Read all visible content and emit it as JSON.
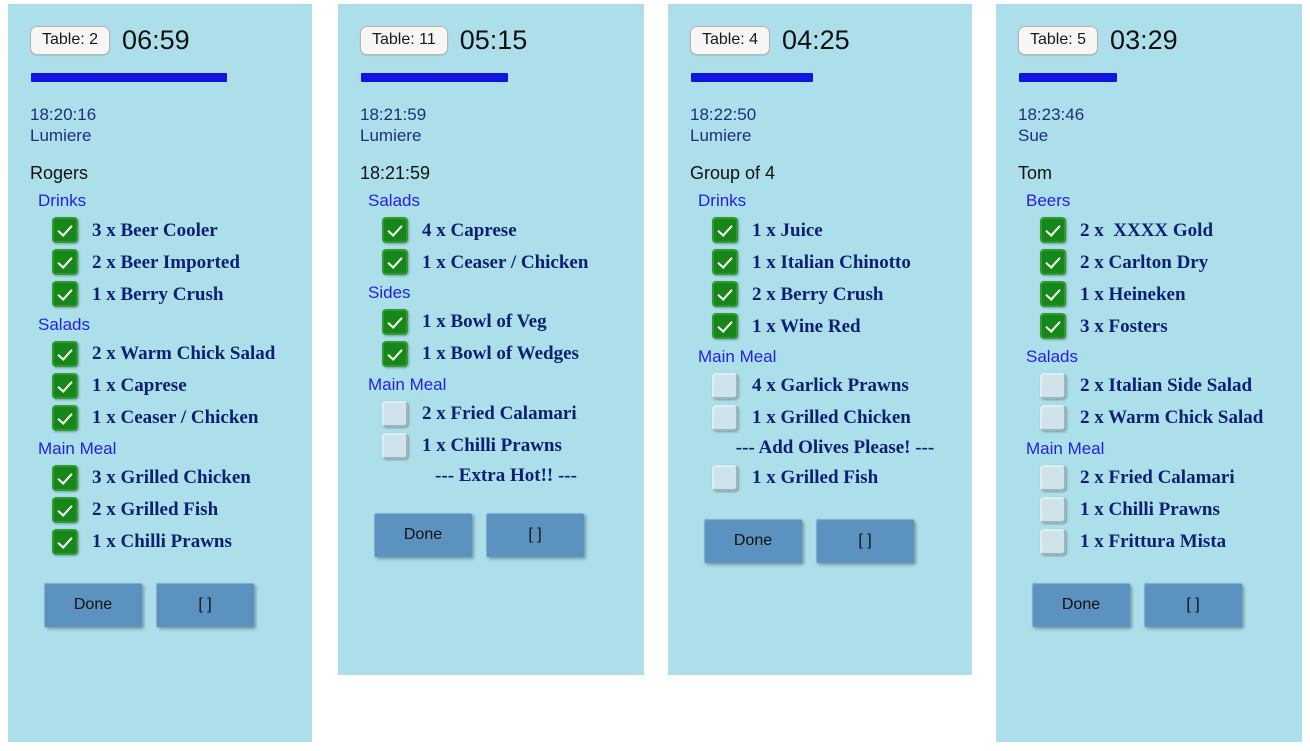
{
  "theme": {
    "card_bg": "#addfeb",
    "page_bg": "#ffffff",
    "progress_color": "#1414e0",
    "checked_color": "#18871a",
    "unchecked_color": "#cfe3ea",
    "course_color": "#2222dd",
    "item_color": "#0f2070",
    "button_color": "#5b92bf"
  },
  "buttons": {
    "done_label": "Done",
    "bracket_label": "[ ]"
  },
  "orders": [
    {
      "table_label": "Table: 2",
      "elapsed": "06:59",
      "progress_pct": 70,
      "order_time": "18:20:16",
      "waiter": "Lumiere",
      "customer": "Rogers",
      "courses": [
        {
          "name": "Drinks",
          "items": [
            {
              "qty": "3 x",
              "name": "Beer Cooler",
              "checked": true
            },
            {
              "qty": "2 x",
              "name": "Beer Imported",
              "checked": true
            },
            {
              "qty": "1 x",
              "name": "Berry Crush",
              "checked": true
            }
          ]
        },
        {
          "name": "Salads",
          "items": [
            {
              "qty": "2 x",
              "name": "Warm Chick Salad",
              "checked": true
            },
            {
              "qty": "1 x",
              "name": "Caprese",
              "checked": true
            },
            {
              "qty": "1 x",
              "name": "Ceaser / Chicken",
              "checked": true
            }
          ]
        },
        {
          "name": "Main Meal",
          "items": [
            {
              "qty": "3 x",
              "name": "Grilled Chicken",
              "checked": true
            },
            {
              "qty": "2 x",
              "name": "Grilled Fish",
              "checked": true
            },
            {
              "qty": "1 x",
              "name": "Chilli Prawns",
              "checked": true
            }
          ]
        }
      ]
    },
    {
      "table_label": "Table: 11",
      "elapsed": "05:15",
      "progress_pct": 52,
      "order_time": "18:21:59",
      "waiter": "Lumiere",
      "customer": "18:21:59",
      "courses": [
        {
          "name": "Salads",
          "items": [
            {
              "qty": "4 x",
              "name": "Caprese",
              "checked": true
            },
            {
              "qty": "1 x",
              "name": "Ceaser / Chicken",
              "checked": true
            }
          ]
        },
        {
          "name": "Sides",
          "items": [
            {
              "qty": "1 x",
              "name": "Bowl of Veg",
              "checked": true
            },
            {
              "qty": "1 x",
              "name": "Bowl of Wedges",
              "checked": true
            }
          ]
        },
        {
          "name": "Main Meal",
          "items": [
            {
              "qty": "2 x",
              "name": "Fried Calamari",
              "checked": false
            },
            {
              "qty": "1 x",
              "name": "Chilli Prawns",
              "checked": false
            },
            {
              "note": "--- Extra Hot!! ---"
            }
          ]
        }
      ]
    },
    {
      "table_label": "Table: 4",
      "elapsed": "04:25",
      "progress_pct": 43,
      "order_time": "18:22:50",
      "waiter": "Lumiere",
      "customer": "Group of 4",
      "courses": [
        {
          "name": "Drinks",
          "items": [
            {
              "qty": "1 x",
              "name": "Juice",
              "checked": true
            },
            {
              "qty": "1 x",
              "name": "Italian Chinotto",
              "checked": true
            },
            {
              "qty": "2 x",
              "name": "Berry Crush",
              "checked": true
            },
            {
              "qty": "1 x",
              "name": "Wine Red",
              "checked": true
            }
          ]
        },
        {
          "name": "Main Meal",
          "items": [
            {
              "qty": "4 x",
              "name": "Garlick Prawns",
              "checked": false
            },
            {
              "qty": "1 x",
              "name": "Grilled Chicken",
              "checked": false
            },
            {
              "note": "--- Add Olives Please! ---"
            },
            {
              "qty": "1 x",
              "name": "Grilled Fish",
              "checked": false
            }
          ]
        }
      ]
    },
    {
      "table_label": "Table: 5",
      "elapsed": "03:29",
      "progress_pct": 35,
      "order_time": "18:23:46",
      "waiter": "Sue",
      "customer": "Tom",
      "courses": [
        {
          "name": "Beers",
          "items": [
            {
              "qty": "2 x",
              "name": " XXXX Gold",
              "checked": true
            },
            {
              "qty": "2 x",
              "name": "Carlton Dry",
              "checked": true
            },
            {
              "qty": "1 x",
              "name": "Heineken",
              "checked": true
            },
            {
              "qty": "3 x",
              "name": "Fosters",
              "checked": true
            }
          ]
        },
        {
          "name": "Salads",
          "items": [
            {
              "qty": "2 x",
              "name": "Italian Side Salad",
              "checked": false
            },
            {
              "qty": "2 x",
              "name": "Warm Chick Salad",
              "checked": false
            }
          ]
        },
        {
          "name": "Main Meal",
          "items": [
            {
              "qty": "2 x",
              "name": "Fried Calamari",
              "checked": false
            },
            {
              "qty": "1 x",
              "name": "Chilli Prawns",
              "checked": false
            },
            {
              "qty": "1 x",
              "name": "Frittura Mista",
              "checked": false
            }
          ]
        }
      ]
    }
  ]
}
